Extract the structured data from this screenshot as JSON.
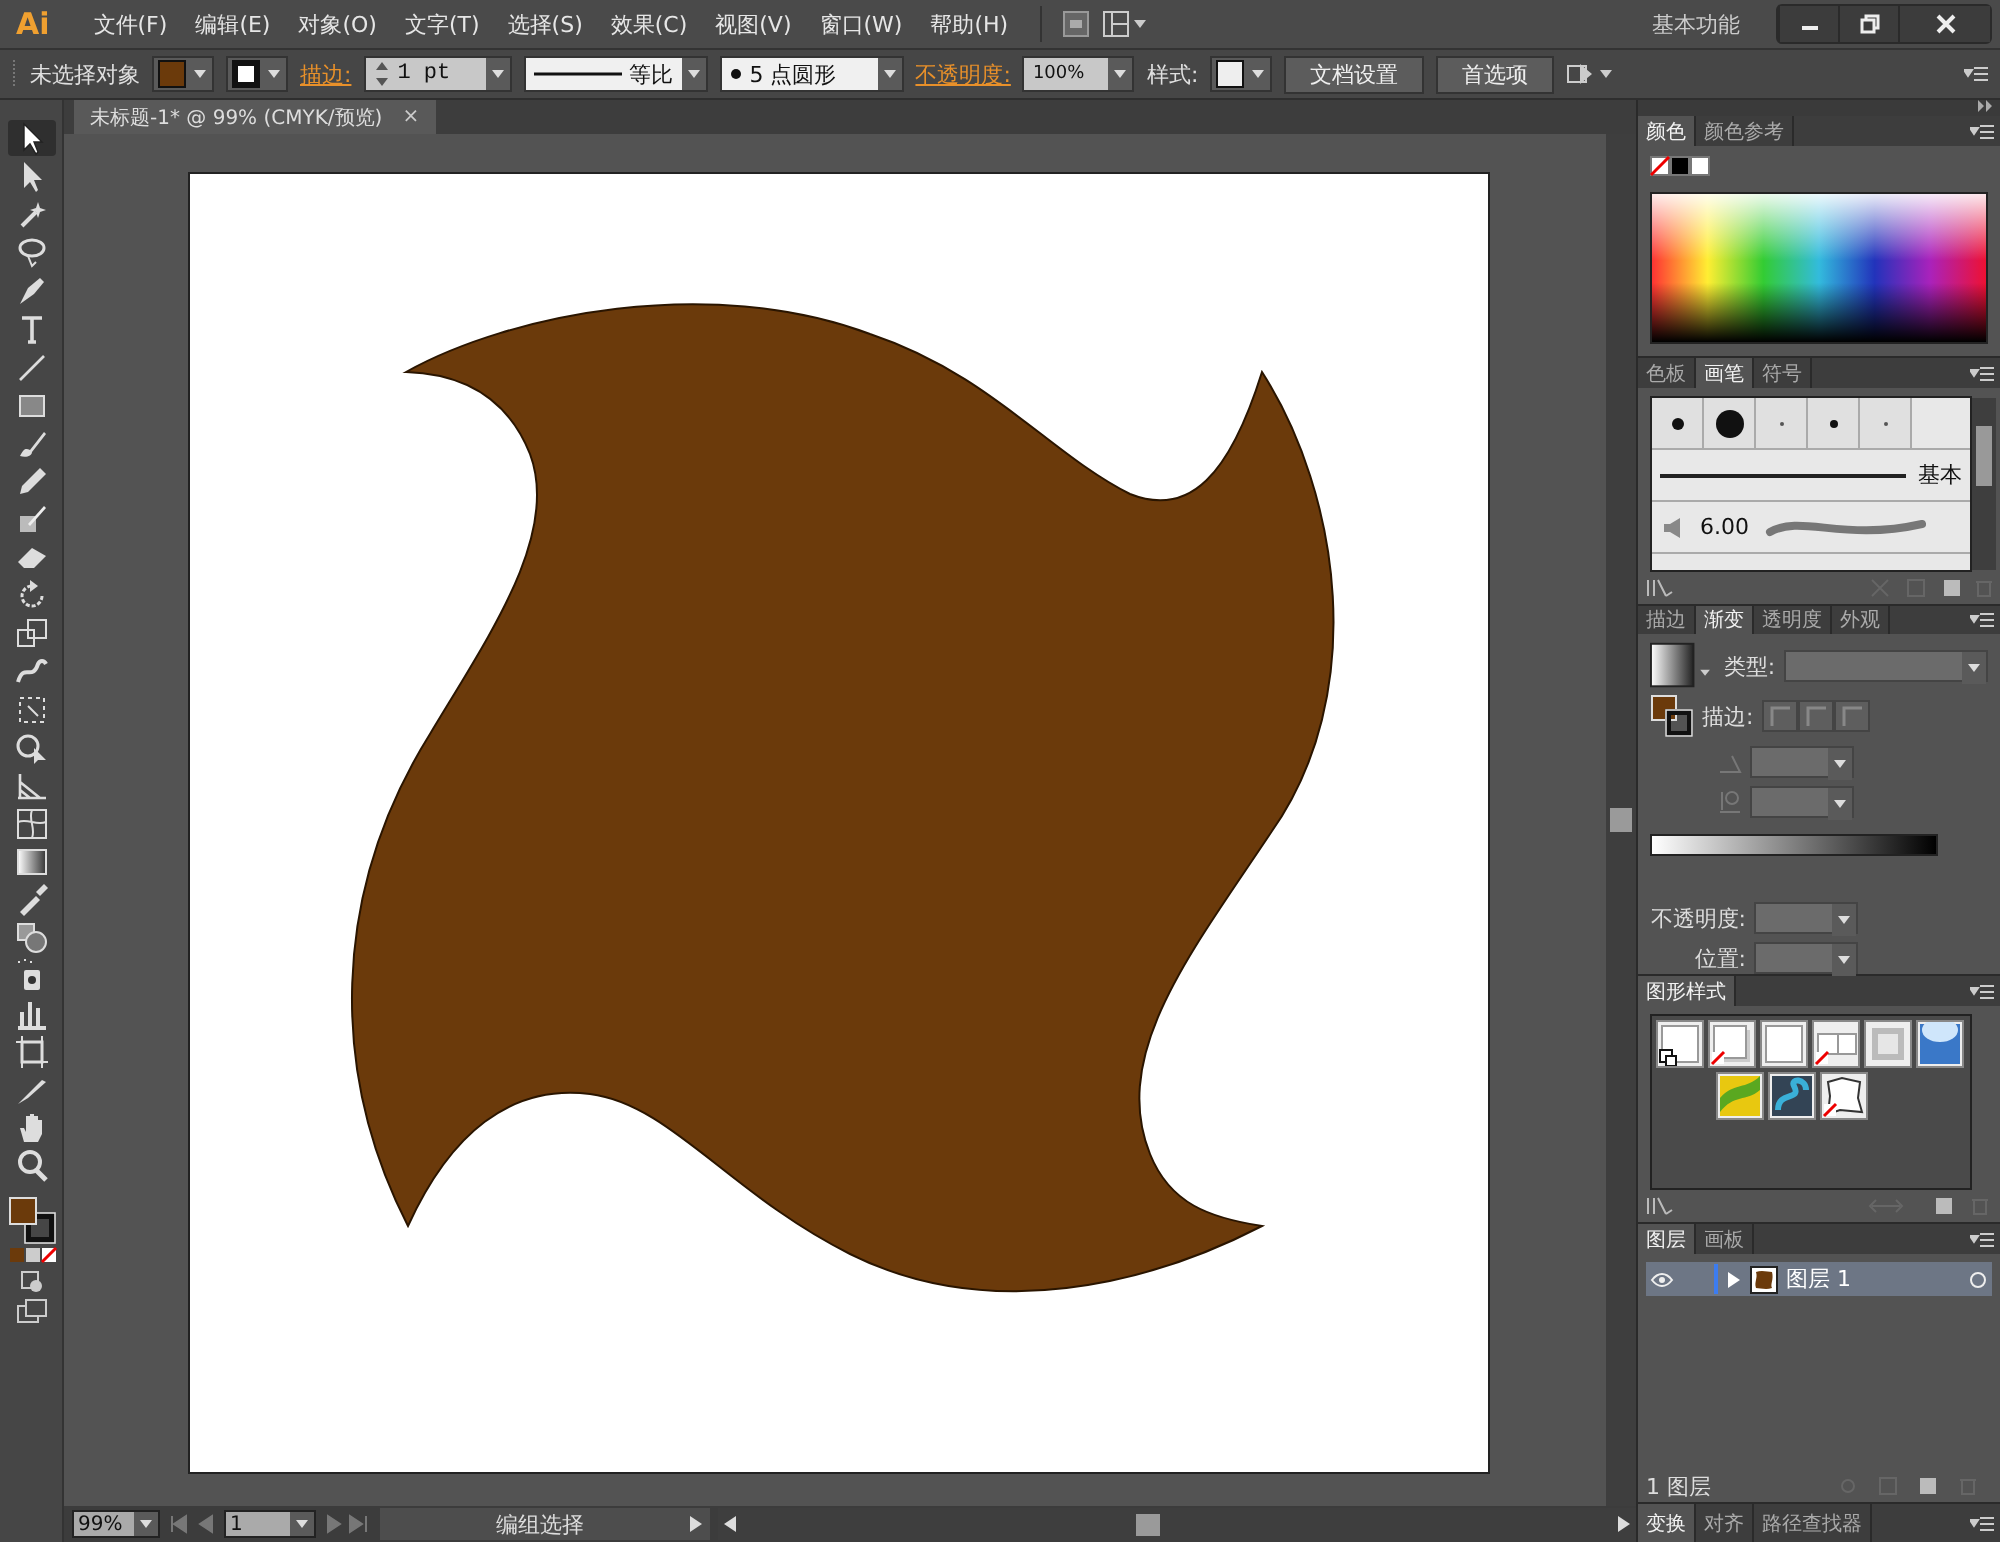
{
  "menubar": {
    "logo": "Ai",
    "menus": [
      "文件(F)",
      "编辑(E)",
      "对象(O)",
      "文字(T)",
      "选择(S)",
      "效果(C)",
      "视图(V)",
      "窗口(W)",
      "帮助(H)"
    ],
    "workspace": "基本功能"
  },
  "control_bar": {
    "selection": "未选择对象",
    "stroke_label": "描边:",
    "stroke_weight": "1 pt",
    "stroke_profile": "等比",
    "brush": "5 点圆形",
    "opacity_label": "不透明度:",
    "opacity": "100%",
    "style_label": "样式:",
    "buttons": [
      "文档设置",
      "首选项"
    ]
  },
  "document_tab": {
    "title": "未标题-1* @ 99% (CMYK/预览)",
    "close": "×"
  },
  "tools": [
    {
      "kind": "select",
      "selected": true
    },
    {
      "kind": "direct",
      "selected": false
    },
    {
      "kind": "magic",
      "selected": false
    },
    {
      "kind": "lasso",
      "selected": false
    },
    {
      "kind": "pen",
      "selected": false
    },
    {
      "kind": "type",
      "selected": false
    },
    {
      "kind": "line",
      "selected": false
    },
    {
      "kind": "rect",
      "selected": false
    },
    {
      "kind": "brush",
      "selected": false
    },
    {
      "kind": "pencil",
      "selected": false
    },
    {
      "kind": "blob",
      "selected": false
    },
    {
      "kind": "eraser",
      "selected": false
    },
    {
      "kind": "rotate",
      "selected": false
    },
    {
      "kind": "scale",
      "selected": false
    },
    {
      "kind": "warp",
      "selected": false
    },
    {
      "kind": "transform",
      "selected": false
    },
    {
      "kind": "builder",
      "selected": false
    },
    {
      "kind": "grid",
      "selected": false
    },
    {
      "kind": "mesh",
      "selected": false
    },
    {
      "kind": "gradient",
      "selected": false
    },
    {
      "kind": "eyedropper",
      "selected": false
    },
    {
      "kind": "blend",
      "selected": false
    },
    {
      "kind": "spray",
      "selected": false
    },
    {
      "kind": "graph",
      "selected": false
    },
    {
      "kind": "artboard",
      "selected": false
    },
    {
      "kind": "knife",
      "selected": false
    },
    {
      "kind": "hand",
      "selected": false
    },
    {
      "kind": "zoom",
      "selected": false
    }
  ],
  "color_panel": {
    "tabs": [
      {
        "label": "颜色",
        "selected": true
      },
      {
        "label": "颜色参考",
        "selected": false
      }
    ]
  },
  "brush_panel": {
    "tabs": [
      {
        "label": "色板",
        "selected": false
      },
      {
        "label": "画笔",
        "selected": true
      },
      {
        "label": "符号",
        "selected": false
      }
    ],
    "brushes": [
      {
        "kind": "line",
        "label": "基本"
      },
      {
        "kind": "calligraphic",
        "label": "6.00"
      }
    ]
  },
  "gradient_panel": {
    "tabs": [
      {
        "label": "描边",
        "selected": false
      },
      {
        "label": "渐变",
        "selected": true
      },
      {
        "label": "透明度",
        "selected": false
      },
      {
        "label": "外观",
        "selected": false
      }
    ],
    "type_label": "类型:",
    "stroke_label": "描边:",
    "opacity_label": "不透明度:",
    "position_label": "位置:"
  },
  "graphic_styles": {
    "tabs": [
      {
        "label": "图形样式",
        "selected": true
      }
    ],
    "styles": [
      {
        "kind": "default"
      },
      {
        "kind": "shadow"
      },
      {
        "kind": "plain"
      },
      {
        "kind": "split"
      },
      {
        "kind": "bevel"
      },
      {
        "kind": "glow"
      },
      {
        "kind": "leaf"
      },
      {
        "kind": "swirl"
      },
      {
        "kind": "rough"
      }
    ]
  },
  "layers_panel": {
    "tabs": [
      {
        "label": "图层",
        "selected": true
      },
      {
        "label": "画板",
        "selected": false
      }
    ],
    "layers": [
      {
        "name": "图层 1",
        "visible": true,
        "expanded": false
      }
    ],
    "count": "1 图层"
  },
  "bottom_tabs": [
    {
      "label": "变换",
      "selected": true
    },
    {
      "label": "对齐",
      "selected": false
    },
    {
      "label": "路径查找器",
      "selected": false
    }
  ],
  "status_bar": {
    "zoom": "99%",
    "page": "1",
    "status": "编组选择"
  }
}
